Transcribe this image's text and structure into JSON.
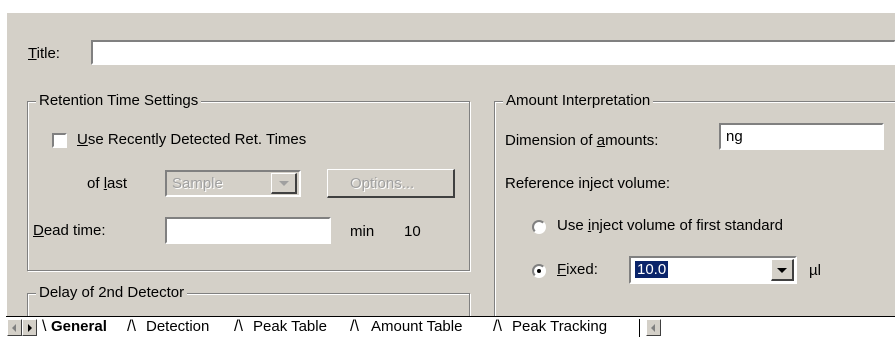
{
  "title_field": {
    "label_u": "T",
    "label_rest": "itle:",
    "value": ""
  },
  "retention": {
    "group_title": "Retention Time Settings",
    "use_recent": {
      "u": "U",
      "rest": "se Recently Detected Ret. Times",
      "checked": false
    },
    "of_last": {
      "pre": "of ",
      "u": "l",
      "rest": "ast"
    },
    "sample_select": "Sample",
    "options_button": "Options...",
    "dead_time": {
      "u": "D",
      "rest": "ead time:",
      "value": "",
      "unit": "min",
      "extra": "10"
    }
  },
  "delay": {
    "group_title": "Delay of 2nd Detector"
  },
  "amount": {
    "group_title": "Amount Interpretation",
    "dimension": {
      "pre": "Dimension of ",
      "u": "a",
      "rest": "mounts:",
      "value": "ng"
    },
    "ref_label": "Reference inject volume:",
    "opt_first": {
      "pre": "Use ",
      "u": "i",
      "rest": "nject volume of first standard",
      "selected": false
    },
    "opt_fixed": {
      "u": "F",
      "rest": "ixed:",
      "selected": true,
      "value": "10.0",
      "unit": "µl"
    }
  },
  "tabs": [
    "General",
    "Detection",
    "Peak Table",
    "Amount Table",
    "Peak Tracking"
  ],
  "active_tab": "General",
  "colors": {
    "panel": "#d4d0c8",
    "selection": "#0a246a"
  }
}
